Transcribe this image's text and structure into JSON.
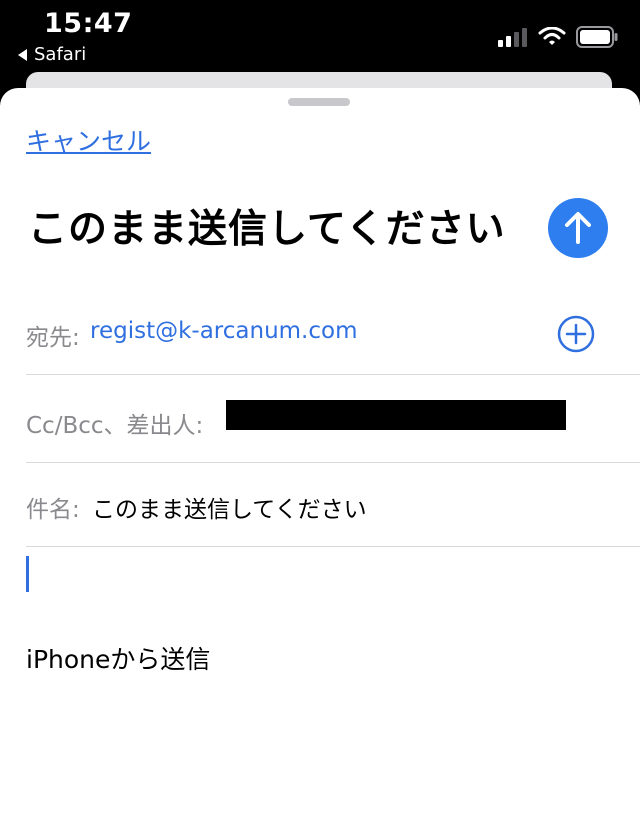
{
  "status_bar": {
    "time": "15:47",
    "back_app": "Safari",
    "icons": [
      "signal-icon",
      "wifi-icon",
      "battery-icon"
    ]
  },
  "compose": {
    "cancel_label": "キャンセル",
    "title": "このまま送信してください",
    "send_icon": "arrow-up-icon",
    "accent_color": "#2f7ef0",
    "to": {
      "label": "宛先:",
      "value": "regist@k-arcanum.com",
      "add_icon": "plus-circle-icon"
    },
    "cc": {
      "label": "Cc/Bcc、差出人:"
    },
    "subject": {
      "label": "件名:",
      "value": "このまま送信してください"
    },
    "body": {
      "signature": "iPhoneから送信"
    }
  }
}
